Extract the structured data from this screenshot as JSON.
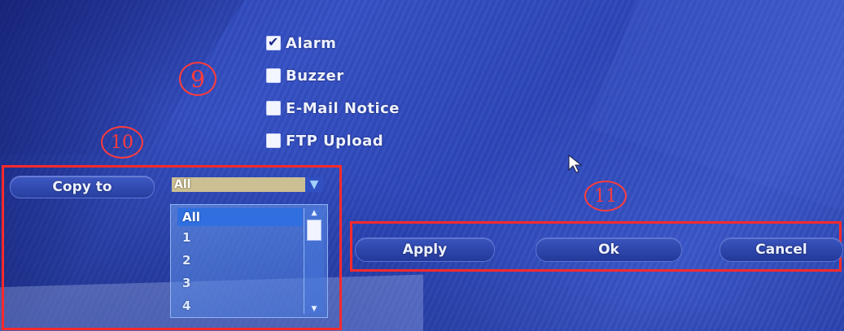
{
  "options": [
    {
      "label": "Alarm",
      "checked": true
    },
    {
      "label": "Buzzer",
      "checked": false
    },
    {
      "label": "E-Mail Notice",
      "checked": false
    },
    {
      "label": "FTP Upload",
      "checked": false
    }
  ],
  "annotations": {
    "nine": "9",
    "ten": "10",
    "eleven": "11"
  },
  "copy": {
    "button_label": "Copy to",
    "selected_value": "All",
    "arrow_icon": "chevron-down-icon",
    "dropdown_items": [
      "All",
      "1",
      "2",
      "3",
      "4"
    ]
  },
  "actions": {
    "apply_label": "Apply",
    "ok_label": "Ok",
    "cancel_label": "Cancel"
  },
  "colors": {
    "background": "#3550c4",
    "highlight": "#ff2a2a",
    "selected_item": "#2f6fe0",
    "select_value_bg": "#cbbf93"
  }
}
